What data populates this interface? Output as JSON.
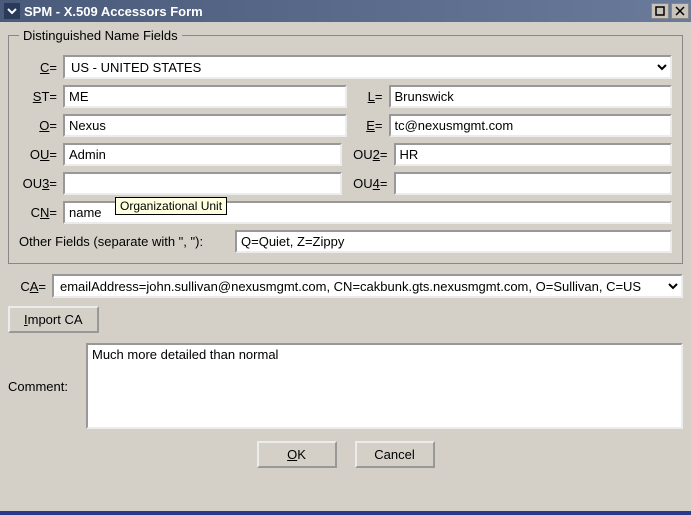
{
  "window": {
    "title": "SPM - X.509 Accessors Form"
  },
  "dn_legend": "Distinguished Name Fields",
  "labels": {
    "c_pre": "C",
    "c_post": "=",
    "st_pre": "S",
    "st_mid": "T",
    "st_post": "=",
    "l_pre": "L",
    "l_post": "=",
    "o_pre": "O",
    "o_post": "=",
    "e_pre": "E",
    "e_post": "=",
    "ou_pre": "O",
    "ou_mid": "U",
    "ou_post": "=",
    "ou2_pre": "OU",
    "ou2_mid": "2",
    "ou2_post": "=",
    "ou3_pre": "OU",
    "ou3_mid": "3",
    "ou3_post": "=",
    "ou4_pre": "OU",
    "ou4_mid": "4",
    "ou4_post": "=",
    "cn_pre": "C",
    "cn_mid": "N",
    "cn_post": "=",
    "other": "Other Fields (separate with \", \"):",
    "ca_pre": "C",
    "ca_mid": "A",
    "ca_post": "=",
    "import_pre": "I",
    "import_post": "mport CA",
    "comment": "Comment:",
    "ok_pre": "O",
    "ok_post": "K",
    "cancel": "Cancel"
  },
  "fields": {
    "c": "US - UNITED STATES",
    "st": "ME",
    "l": "Brunswick",
    "o": "Nexus",
    "e": "tc@nexusmgmt.com",
    "ou": "Admin",
    "ou2": "HR",
    "ou3": "",
    "ou4": "",
    "cn": "name",
    "other": "Q=Quiet, Z=Zippy",
    "ca": "emailAddress=john.sullivan@nexusmgmt.com, CN=cakbunk.gts.nexusmgmt.com, O=Sullivan, C=US",
    "comment": "Much more detailed than normal"
  },
  "tooltip": "Organizational Unit"
}
